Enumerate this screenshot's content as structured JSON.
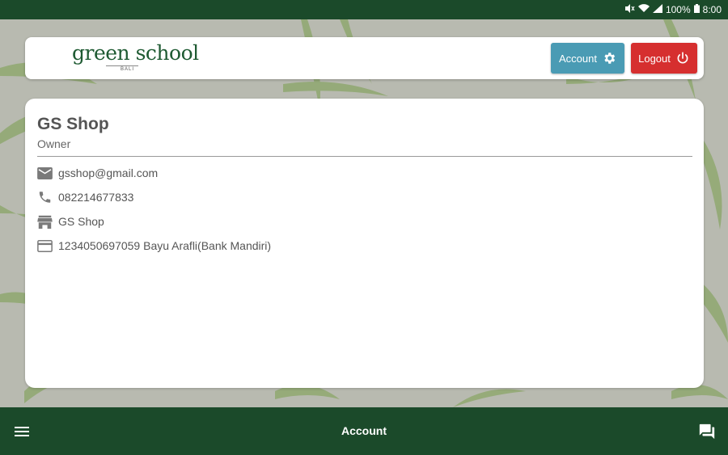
{
  "status_bar": {
    "battery": "100%",
    "time": "8:00"
  },
  "header": {
    "logo_text": "green school",
    "logo_sub": "BALI",
    "account_label": "Account",
    "logout_label": "Logout"
  },
  "profile": {
    "name": "GS Shop",
    "role": "Owner",
    "email": "gsshop@gmail.com",
    "phone": "082214677833",
    "store": "GS Shop",
    "bank": "1234050697059 Bayu Arafli(Bank Mandiri)"
  },
  "bottom_bar": {
    "title": "Account"
  },
  "colors": {
    "brand_green": "#1b4a2a",
    "account_button": "#4a9bb4",
    "logout_button": "#d62f2f"
  },
  "icons": {
    "email": "email-icon",
    "phone": "phone-icon",
    "store": "store-icon",
    "bank": "credit-card-icon",
    "account_button": "gear-icon",
    "logout_button": "power-icon",
    "menu": "hamburger-menu-icon",
    "chat": "chat-icon"
  }
}
